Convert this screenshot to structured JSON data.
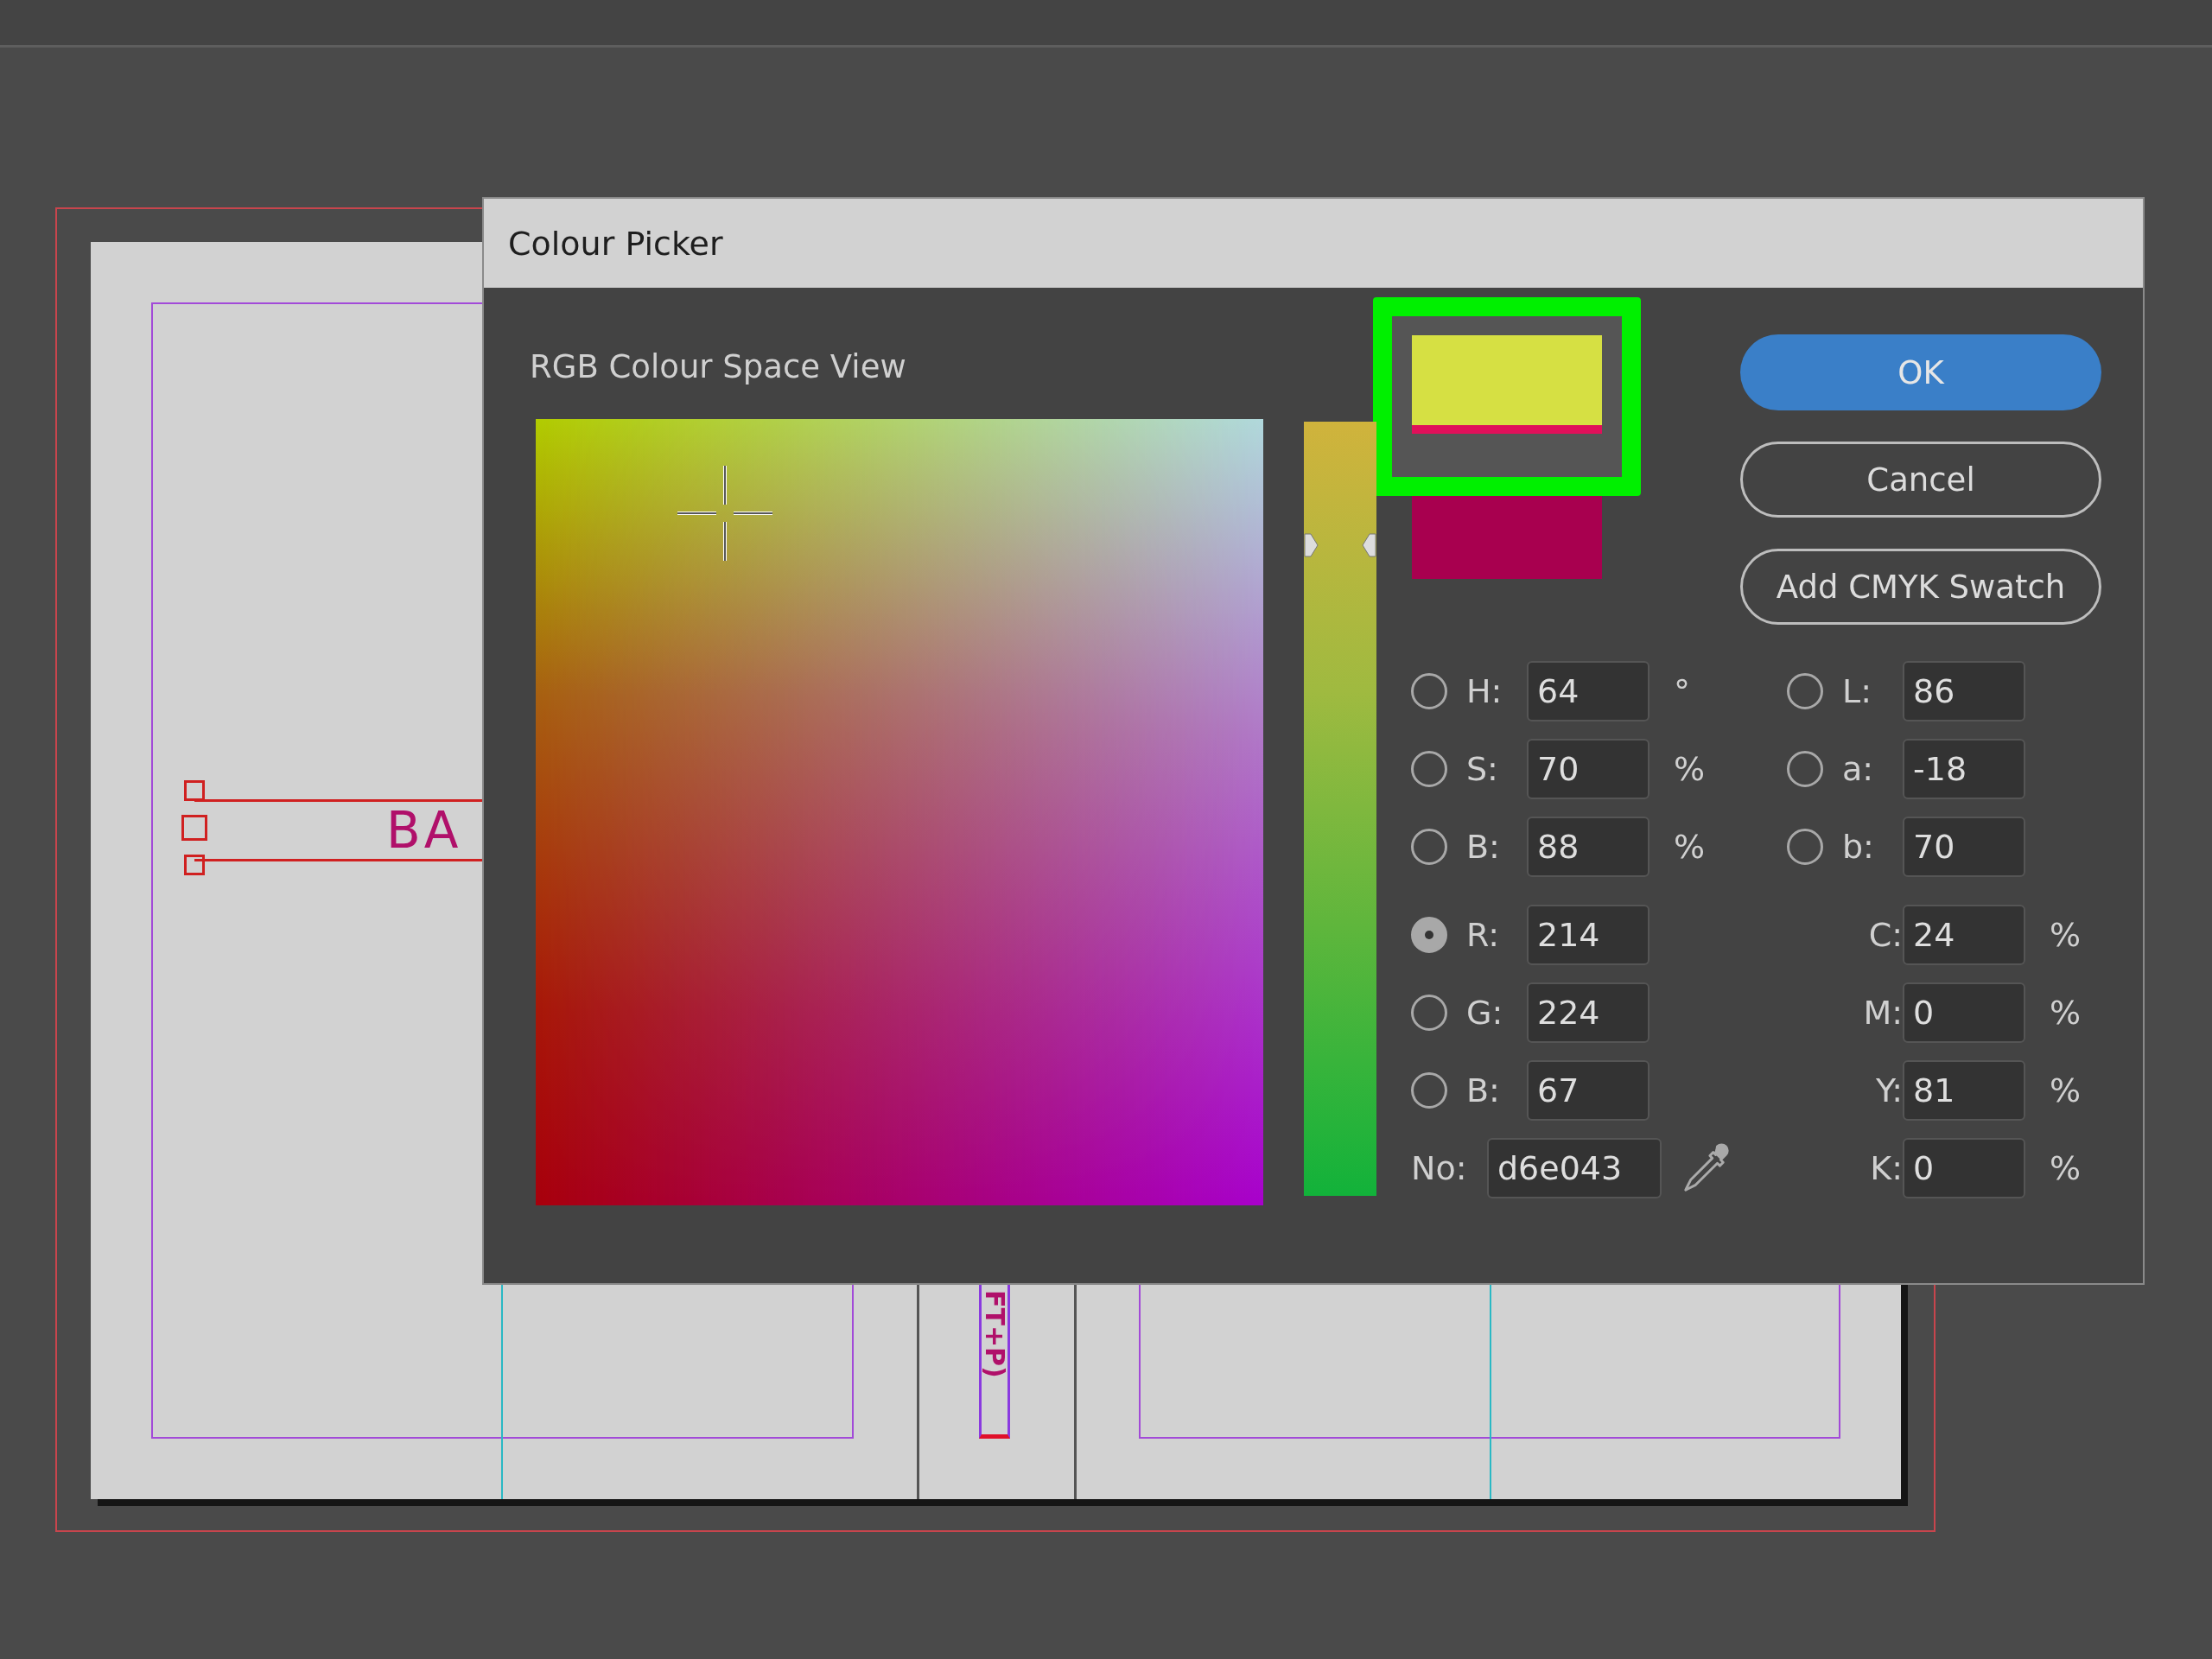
{
  "document": {
    "text_frame": "BA",
    "vertical_frame": "FT+P)"
  },
  "dialog": {
    "title": "Colour Picker",
    "view_label": "RGB Colour Space View",
    "hue_slider": {
      "level": 0.84
    },
    "swatches": [
      {
        "kind": "new",
        "color": "#d6e043"
      },
      {
        "kind": "old",
        "color": "#a8004f"
      }
    ],
    "buttons": [
      {
        "label": "OK",
        "kind": "primary"
      },
      {
        "label": "Cancel",
        "kind": "secondary"
      },
      {
        "label": "Add CMYK Swatch",
        "kind": "secondary"
      }
    ],
    "hsb": [
      {
        "kind": "radio",
        "label": "H:",
        "value": "64",
        "unit": "°",
        "selected": false
      },
      {
        "kind": "radio",
        "label": "S:",
        "value": "70",
        "unit": "%",
        "selected": false
      },
      {
        "kind": "radio",
        "label": "B:",
        "value": "88",
        "unit": "%",
        "selected": false
      }
    ],
    "lab": [
      {
        "kind": "radio",
        "label": "L:",
        "value": "86",
        "selected": false
      },
      {
        "kind": "radio",
        "label": "a:",
        "value": "-18",
        "selected": false
      },
      {
        "kind": "radio",
        "label": "b:",
        "value": "70",
        "selected": false
      }
    ],
    "rgb": [
      {
        "kind": "radio",
        "label": "R:",
        "value": "214",
        "selected": true
      },
      {
        "kind": "radio",
        "label": "G:",
        "value": "224",
        "selected": false
      },
      {
        "kind": "radio",
        "label": "B:",
        "value": "67",
        "selected": false
      }
    ],
    "cmyk": [
      {
        "kind": "plain",
        "label": "C:",
        "value": "24",
        "unit": "%"
      },
      {
        "kind": "plain",
        "label": "M:",
        "value": "0",
        "unit": "%"
      },
      {
        "kind": "plain",
        "label": "Y:",
        "value": "81",
        "unit": "%"
      },
      {
        "kind": "plain",
        "label": "K:",
        "value": "0",
        "unit": "%"
      }
    ],
    "hex": {
      "label": "No:",
      "value": "d6e043"
    }
  }
}
